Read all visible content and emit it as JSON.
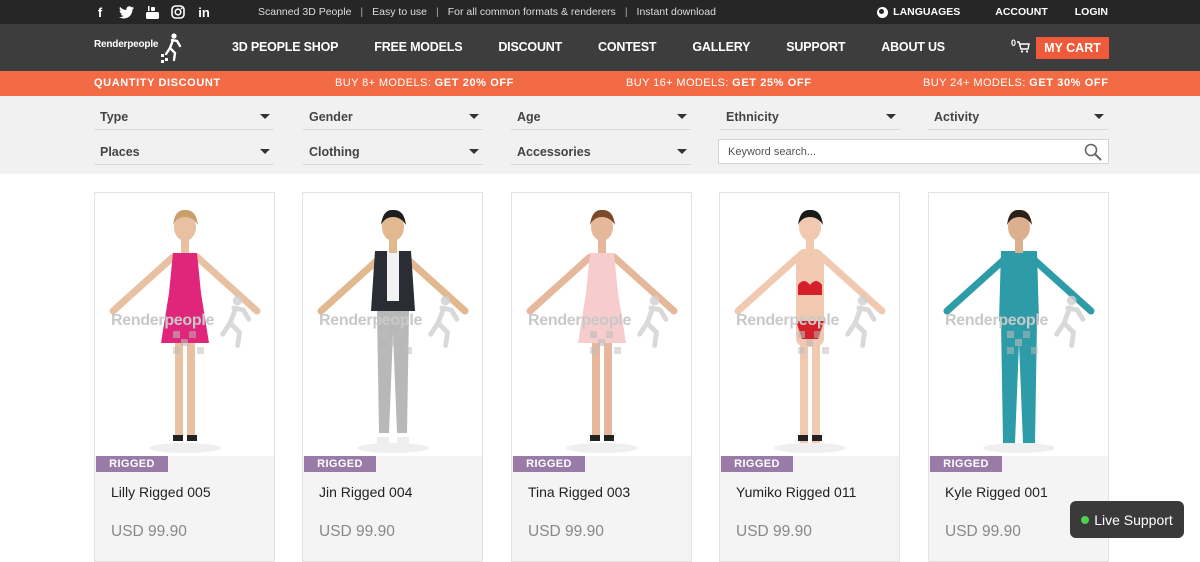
{
  "topbar": {
    "social": [
      {
        "icon": "facebook-icon",
        "glyph": "f"
      },
      {
        "icon": "twitter-icon",
        "glyph": "t"
      },
      {
        "icon": "youtube-icon",
        "glyph": "▶"
      },
      {
        "icon": "instagram-icon",
        "glyph": "◎"
      },
      {
        "icon": "linkedin-icon",
        "glyph": "in"
      }
    ],
    "taglines": [
      "Scanned 3D People",
      "Easy to use",
      "For all common formats & renderers",
      "Instant download"
    ],
    "separator": "|",
    "languages": "LANGUAGES",
    "account": "ACCOUNT",
    "login": "LOGIN"
  },
  "nav": {
    "logo_text": "Renderpeople",
    "menu": [
      "3D PEOPLE SHOP",
      "FREE MODELS",
      "DISCOUNT",
      "CONTEST",
      "GALLERY",
      "SUPPORT",
      "ABOUT US"
    ],
    "cart_count": "0",
    "my_cart": "MY CART"
  },
  "discount": {
    "title": "QUANTITY DISCOUNT",
    "items": [
      {
        "text": "BUY 8+ MODELS:",
        "bold": "GET 20% OFF"
      },
      {
        "text": "BUY 16+ MODELS:",
        "bold": "GET 25% OFF"
      },
      {
        "text": "BUY 24+ MODELS:",
        "bold": "GET 30% OFF"
      }
    ]
  },
  "filters": {
    "row1": [
      "Type",
      "Gender",
      "Age",
      "Ethnicity",
      "Activity"
    ],
    "row2": [
      "Places",
      "Clothing",
      "Accessories"
    ],
    "search_placeholder": "Keyword search..."
  },
  "watermark": "Renderpeople",
  "products": [
    {
      "badge": "RIGGED",
      "name": "Lilly Rigged 005",
      "price": "USD 99.90",
      "skin": "#e8c1a3",
      "hair": "#c9a06a",
      "top": "#e0267a",
      "bottom": "#e0267a",
      "style": "dress"
    },
    {
      "badge": "RIGGED",
      "name": "Jin Rigged 004",
      "price": "USD 99.90",
      "skin": "#e2b88f",
      "hair": "#1e1e1e",
      "top": "#2b2d35",
      "bottom": "#b8b8b8",
      "style": "suit"
    },
    {
      "badge": "RIGGED",
      "name": "Tina Rigged 003",
      "price": "USD 99.90",
      "skin": "#e6b89b",
      "hair": "#7a4a2a",
      "top": "#f6cccd",
      "bottom": "#f6cccd",
      "style": "dress"
    },
    {
      "badge": "RIGGED",
      "name": "Yumiko Rigged 011",
      "price": "USD 99.90",
      "skin": "#f0c9b0",
      "hair": "#1a1a1a",
      "top": "#d4202a",
      "bottom": "#d4202a",
      "style": "bikini"
    },
    {
      "badge": "RIGGED",
      "name": "Kyle Rigged 001",
      "price": "USD 99.90",
      "skin": "#dcb08e",
      "hair": "#2b2118",
      "top": "#2e9ba8",
      "bottom": "#2e9ba8",
      "style": "scrubs"
    }
  ],
  "live_support": "Live Support"
}
